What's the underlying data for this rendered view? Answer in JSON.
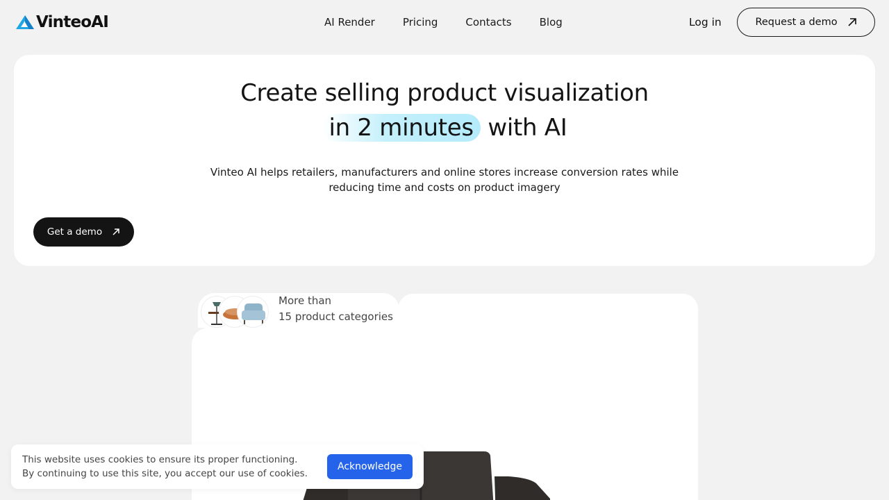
{
  "header": {
    "logo_text": "VinteoAI",
    "nav": [
      "AI Render",
      "Pricing",
      "Contacts",
      "Blog"
    ],
    "login_label": "Log in",
    "request_demo_label": "Request a demo"
  },
  "hero": {
    "title_line1": "Create selling product visualization",
    "title_highlight": "in 2 minutes",
    "title_rest": "with AI",
    "subtitle_line1": "Vinteo AI helps retailers, manufacturers and online stores increase conversion rates while",
    "subtitle_line2": "reducing time and costs on product imagery",
    "cta_label": "Get a demo"
  },
  "showcase": {
    "categories_line1": "More than",
    "categories_line2": "15 product categories"
  },
  "cookie": {
    "line1": "This website uses cookies to ensure its proper functioning.",
    "line2": "By continuing to use this site, you accept our use of cookies.",
    "button_label": "Acknowledge"
  },
  "colors": {
    "accent": "#2563eb",
    "logo_blue": "#1ea7e4",
    "highlight": "#c4f0fb",
    "dark_button": "#141414"
  }
}
